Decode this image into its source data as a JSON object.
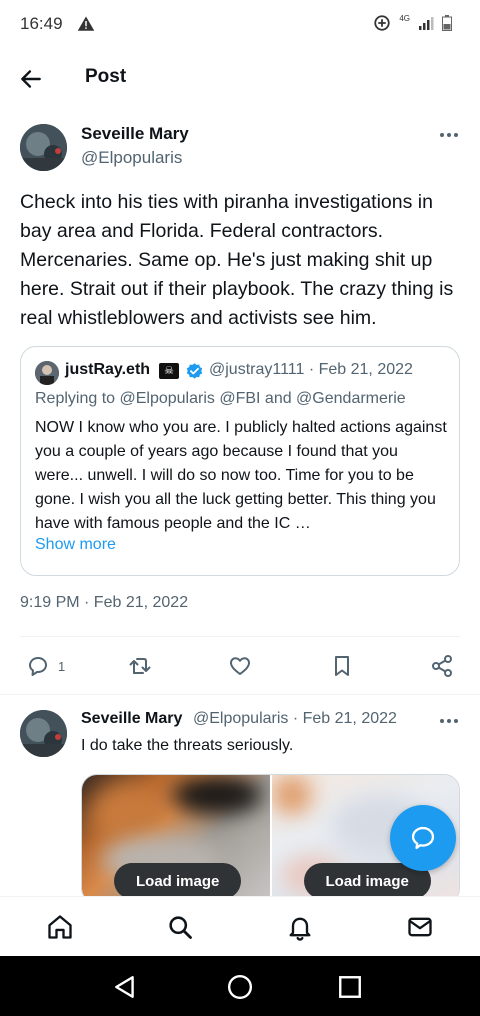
{
  "status_bar": {
    "time": "16:49",
    "network": "4G"
  },
  "header": {
    "title": "Post"
  },
  "tweet": {
    "author_name": "Seveille Mary",
    "author_handle": "@Elpopularis",
    "text": "Check into his ties with piranha investigations in bay area and Florida. Federal contractors. Mercenaries. Same op. He's just making shit up here. Strait out if their playbook. The crazy thing is real whistleblowers and activists see him.",
    "timestamp": "9:19 PM · Feb 21, 2022",
    "reply_count": "1"
  },
  "quote": {
    "author_name": "justRay.eth",
    "author_handle_date": "@justray1111 · Feb 21, 2022",
    "replying_to": "Replying to @Elpopularis @FBI and @Gendarmerie",
    "text": "NOW I know who you are. I publicly halted actions against you a couple of years ago because I found that you were... unwell. I will do so now too. Time for you to be gone. I wish you all the luck getting better. This thing you have with famous people and the IC …",
    "show_more": "Show more"
  },
  "reply": {
    "author_name": "Seveille Mary",
    "author_handle_date": "@Elpopularis · Feb 21, 2022",
    "text": "I do take the threats seriously.",
    "load_image_left": "Load image",
    "load_image_right": "Load image"
  },
  "colors": {
    "accent": "#1d9bf0",
    "text": "#0f1419",
    "secondary_text": "#536471",
    "border": "#cfd9de"
  }
}
